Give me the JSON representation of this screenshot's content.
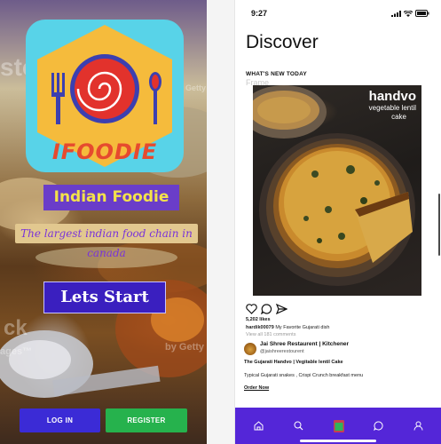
{
  "left_screen": {
    "logo_text": "IFOODIE",
    "badge_title": "Indian Foodie",
    "tagline": "The largest indian food chain in canada",
    "start_button": "Lets Start",
    "login_button": "LOG IN",
    "register_button": "REGISTER",
    "watermarks": [
      "stock",
      "by Getty",
      "ages™",
      "ck",
      "by Getty"
    ],
    "colors": {
      "badge_bg": "#6a3dc9",
      "badge_text": "#f3e24a",
      "start_bg": "#3a1fbf",
      "login_bg": "#3b2bd6",
      "register_bg": "#26b24d",
      "logo_tile": "#58d3e8",
      "logo_hex": "#f5bb3c"
    }
  },
  "right_screen": {
    "status": {
      "time": "9:27",
      "icons": [
        "signal-icon",
        "wifi-icon",
        "battery-icon"
      ]
    },
    "title": "Discover",
    "section_label": "WHAT'S NEW TODAY",
    "frame_label": "Frame",
    "post": {
      "image_title": "handvo",
      "image_subtitle_line1": "vegetable lentil",
      "image_subtitle_line2": "cake",
      "actions": [
        "heart-icon",
        "comment-icon",
        "share-icon"
      ],
      "likes": "5,202 likes",
      "caption_user": "hardik00079",
      "caption_text": "My Favorite Gujarati dish",
      "comments_link": "View all 181 comments",
      "restaurant_name": "Jai Shree Restaurent | Kitchener",
      "restaurant_handle": "@jaishreerestourent",
      "dish_title": "The Gujarati Handvo | Vegitable lentil Cake",
      "dish_description": "Typical Gujarati snakes , Crispi Crunch breakfast menu",
      "order_link": "Order Now"
    },
    "bottom_nav": [
      "home-icon",
      "search-icon",
      "add-post-icon",
      "chat-icon",
      "profile-icon"
    ],
    "colors": {
      "nav_bg": "#5426d8",
      "text": "#111111",
      "muted": "#9a9a9a"
    }
  }
}
